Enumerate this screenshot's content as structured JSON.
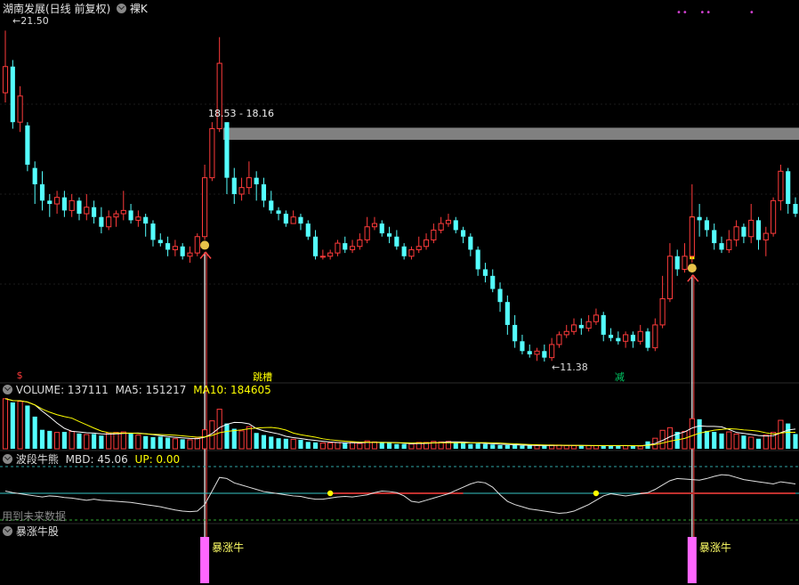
{
  "header": {
    "title": "湖南发展(日线 前复权)",
    "mode": "裸K"
  },
  "colors": {
    "up": "#ff3b3b",
    "down": "#54ffff",
    "ma5": "#ffffff",
    "ma10": "#ffff00",
    "signal": "#ffff00",
    "bull": "#ff66ff",
    "band": "#808080"
  },
  "price_panel": {
    "high_label": "21.50",
    "low_label": "11.38",
    "band_label": "18.53 - 18.16",
    "markers": [
      {
        "index": 2,
        "text": "$",
        "color": "#ff3b3b"
      },
      {
        "index": 34,
        "text": "跳槽",
        "color": "#ffff00"
      },
      {
        "index": 83,
        "text": "减",
        "color": "#00cc66"
      }
    ]
  },
  "volume_panel": {
    "label": "VOLUME: 137111",
    "ma5": "MA5: 151217",
    "ma10": "MA10: 184605"
  },
  "indicator_panel": {
    "name": "波段牛熊",
    "mbd": "MBD: 45.06",
    "up": "UP: 0.00",
    "future_note": "用到未来数据"
  },
  "bull_panel": {
    "name": "暴涨牛股",
    "signal_label": "暴涨牛"
  },
  "chart_data": {
    "type": "candlestick",
    "candles": [
      [
        19.6,
        20.4,
        21.5,
        19.3
      ],
      [
        20.4,
        18.7,
        20.6,
        18.5
      ],
      [
        18.7,
        19.5,
        19.8,
        18.4
      ],
      [
        18.6,
        17.4,
        18.7,
        17.2
      ],
      [
        17.3,
        16.8,
        17.5,
        16.2
      ],
      [
        16.8,
        16.3,
        17.2,
        16.0
      ],
      [
        16.3,
        16.2,
        16.5,
        15.8
      ],
      [
        16.2,
        16.4,
        16.6,
        15.9
      ],
      [
        16.4,
        16.0,
        16.6,
        15.8
      ],
      [
        16.0,
        16.3,
        16.5,
        15.8
      ],
      [
        16.3,
        15.9,
        16.4,
        15.7
      ],
      [
        15.9,
        16.1,
        16.5,
        15.7
      ],
      [
        16.1,
        15.8,
        16.3,
        15.6
      ],
      [
        15.8,
        15.5,
        16.1,
        15.3
      ],
      [
        15.5,
        15.8,
        16.0,
        15.4
      ],
      [
        15.8,
        15.9,
        16.0,
        15.5
      ],
      [
        15.9,
        16.0,
        16.6,
        15.7
      ],
      [
        16.0,
        15.7,
        16.2,
        15.6
      ],
      [
        15.7,
        15.8,
        16.0,
        15.5
      ],
      [
        15.8,
        15.6,
        15.9,
        15.2
      ],
      [
        15.6,
        15.1,
        15.7,
        14.9
      ],
      [
        15.1,
        15.0,
        15.3,
        14.9
      ],
      [
        15.0,
        14.8,
        15.2,
        14.6
      ],
      [
        14.8,
        14.9,
        15.1,
        14.6
      ],
      [
        14.9,
        14.6,
        15.0,
        14.5
      ],
      [
        14.6,
        14.7,
        14.9,
        14.4
      ],
      [
        14.7,
        15.2,
        15.3,
        14.6
      ],
      [
        15.2,
        17.0,
        17.4,
        15.1
      ],
      [
        17.0,
        18.5,
        18.7,
        16.9
      ],
      [
        18.5,
        20.5,
        21.3,
        18.4
      ],
      [
        18.7,
        17.0,
        18.5,
        16.5
      ],
      [
        17.0,
        16.5,
        17.3,
        16.2
      ],
      [
        16.5,
        16.7,
        17.0,
        16.3
      ],
      [
        16.7,
        17.0,
        17.5,
        16.5
      ],
      [
        17.0,
        16.8,
        17.2,
        16.3
      ],
      [
        16.8,
        16.3,
        17.0,
        16.1
      ],
      [
        16.3,
        16.0,
        16.6,
        15.9
      ],
      [
        16.0,
        15.9,
        16.1,
        15.7
      ],
      [
        15.9,
        15.6,
        16.0,
        15.5
      ],
      [
        15.6,
        15.8,
        16.0,
        15.6
      ],
      [
        15.8,
        15.6,
        15.9,
        15.4
      ],
      [
        15.6,
        15.2,
        15.7,
        15.1
      ],
      [
        15.2,
        14.6,
        15.4,
        14.5
      ],
      [
        14.6,
        14.6,
        14.8,
        14.5
      ],
      [
        14.6,
        14.7,
        14.8,
        14.5
      ],
      [
        14.7,
        15.0,
        15.1,
        14.6
      ],
      [
        15.0,
        14.8,
        15.2,
        14.7
      ],
      [
        14.8,
        14.9,
        15.1,
        14.7
      ],
      [
        14.9,
        15.1,
        15.3,
        14.8
      ],
      [
        15.1,
        15.5,
        15.8,
        15.0
      ],
      [
        15.5,
        15.6,
        15.8,
        15.4
      ],
      [
        15.6,
        15.3,
        15.7,
        15.2
      ],
      [
        15.3,
        15.2,
        15.5,
        15.0
      ],
      [
        15.2,
        14.9,
        15.4,
        14.8
      ],
      [
        14.9,
        14.6,
        15.0,
        14.5
      ],
      [
        14.6,
        14.8,
        14.9,
        14.5
      ],
      [
        14.8,
        14.9,
        15.2,
        14.7
      ],
      [
        14.9,
        15.1,
        15.3,
        14.8
      ],
      [
        15.1,
        15.4,
        15.6,
        15.0
      ],
      [
        15.4,
        15.6,
        15.8,
        15.3
      ],
      [
        15.6,
        15.7,
        15.9,
        15.5
      ],
      [
        15.7,
        15.4,
        15.8,
        15.3
      ],
      [
        15.4,
        15.2,
        15.5,
        15.0
      ],
      [
        15.2,
        14.8,
        15.3,
        14.6
      ],
      [
        14.8,
        14.2,
        14.9,
        14.0
      ],
      [
        14.2,
        14.0,
        14.4,
        13.8
      ],
      [
        14.0,
        13.6,
        14.2,
        13.5
      ],
      [
        13.6,
        13.2,
        13.8,
        12.9
      ],
      [
        13.2,
        12.5,
        13.4,
        12.2
      ],
      [
        12.5,
        12.0,
        12.8,
        11.8
      ],
      [
        12.0,
        11.7,
        12.2,
        11.6
      ],
      [
        11.7,
        11.6,
        11.9,
        11.5
      ],
      [
        11.6,
        11.7,
        11.8,
        11.4
      ],
      [
        11.7,
        11.5,
        11.9,
        11.38
      ],
      [
        11.5,
        11.9,
        12.1,
        11.4
      ],
      [
        11.9,
        12.2,
        12.3,
        11.8
      ],
      [
        12.2,
        12.3,
        12.5,
        12.1
      ],
      [
        12.3,
        12.5,
        12.7,
        12.2
      ],
      [
        12.5,
        12.4,
        12.7,
        12.2
      ],
      [
        12.4,
        12.6,
        12.8,
        12.3
      ],
      [
        12.6,
        12.8,
        13.0,
        12.5
      ],
      [
        12.8,
        12.2,
        12.9,
        12.0
      ],
      [
        12.2,
        12.1,
        12.4,
        12.0
      ],
      [
        12.1,
        12.0,
        12.3,
        11.9
      ],
      [
        12.0,
        12.2,
        12.3,
        11.8
      ],
      [
        12.2,
        12.0,
        12.3,
        11.8
      ],
      [
        12.0,
        12.3,
        12.5,
        11.9
      ],
      [
        12.3,
        11.8,
        12.4,
        11.7
      ],
      [
        11.8,
        12.5,
        12.7,
        11.7
      ],
      [
        12.5,
        13.3,
        14.0,
        12.4
      ],
      [
        13.3,
        14.6,
        15.0,
        13.2
      ],
      [
        14.6,
        14.2,
        14.8,
        14.0
      ],
      [
        14.2,
        14.6,
        15.0,
        14.1
      ],
      [
        14.6,
        15.8,
        16.8,
        14.4
      ],
      [
        15.8,
        15.7,
        16.2,
        15.2
      ],
      [
        15.7,
        15.4,
        15.8,
        15.2
      ],
      [
        15.4,
        15.0,
        15.6,
        14.8
      ],
      [
        15.0,
        14.8,
        15.2,
        14.7
      ],
      [
        14.8,
        15.1,
        15.4,
        14.7
      ],
      [
        15.1,
        15.5,
        15.7,
        14.9
      ],
      [
        15.5,
        15.2,
        15.6,
        15.0
      ],
      [
        15.2,
        15.7,
        16.2,
        15.0
      ],
      [
        15.7,
        15.1,
        15.8,
        14.8
      ],
      [
        15.1,
        15.3,
        15.5,
        14.6
      ],
      [
        15.3,
        16.3,
        16.4,
        15.2
      ],
      [
        16.3,
        17.2,
        17.4,
        16.0
      ],
      [
        17.2,
        16.2,
        17.3,
        15.9
      ],
      [
        16.2,
        15.9,
        16.4,
        15.8
      ]
    ],
    "volume": [
      9.5,
      8.8,
      9.0,
      8.2,
      6.1,
      3.6,
      3.4,
      3.1,
      3.2,
      3.3,
      2.9,
      2.7,
      2.8,
      2.5,
      3.0,
      3.1,
      3.2,
      3.0,
      2.6,
      2.4,
      2.2,
      2.3,
      2.1,
      1.9,
      1.8,
      1.7,
      2.0,
      3.6,
      5.3,
      7.5,
      4.8,
      3.8,
      3.4,
      4.2,
      3.0,
      2.6,
      2.3,
      2.0,
      1.9,
      1.8,
      1.7,
      1.3,
      1.2,
      1.1,
      1.1,
      1.2,
      1.1,
      1.2,
      1.0,
      1.5,
      1.3,
      1.1,
      1.1,
      0.9,
      0.9,
      0.9,
      1.2,
      1.2,
      1.4,
      1.3,
      1.4,
      1.2,
      1.1,
      0.9,
      1.0,
      0.9,
      0.8,
      0.7,
      0.7,
      0.7,
      0.6,
      0.6,
      0.6,
      0.6,
      0.7,
      0.7,
      0.6,
      0.6,
      0.6,
      0.6,
      0.6,
      0.6,
      0.6,
      0.6,
      0.6,
      0.5,
      0.5,
      1.4,
      2.0,
      3.5,
      4.0,
      3.2,
      3.3,
      5.7,
      5.6,
      3.4,
      3.2,
      2.9,
      3.2,
      2.8,
      2.5,
      2.2,
      1.9,
      2.6,
      3.1,
      5.4,
      4.8,
      2.8
    ],
    "volume_ylim": [
      0,
      9.8
    ],
    "ylim": [
      11.0,
      22.0
    ],
    "band": [
      18.16,
      18.53
    ],
    "band_start_index": 30,
    "signals": [
      {
        "index": 27,
        "label": "暴涨牛"
      },
      {
        "index": 93,
        "label": "暴涨牛"
      }
    ],
    "mbd_line": [
      55,
      52,
      50,
      48,
      46,
      44,
      46,
      45,
      43,
      42,
      40,
      38,
      40,
      38,
      37,
      36,
      35,
      34,
      32,
      30,
      28,
      26,
      23,
      20,
      18,
      17,
      18,
      30,
      55,
      80,
      78,
      70,
      66,
      62,
      58,
      54,
      52,
      50,
      48,
      46,
      45,
      42,
      40,
      40,
      42,
      44,
      45,
      44,
      46,
      48,
      52,
      55,
      54,
      52,
      46,
      36,
      34,
      38,
      42,
      46,
      50,
      56,
      62,
      68,
      72,
      70,
      62,
      48,
      36,
      30,
      26,
      22,
      20,
      18,
      16,
      14,
      15,
      18,
      24,
      30,
      38,
      46,
      50,
      48,
      46,
      48,
      50,
      52,
      58,
      66,
      74,
      78,
      77,
      76,
      75,
      78,
      82,
      85,
      84,
      80,
      76,
      74,
      72,
      70,
      68,
      72,
      70,
      68,
      66,
      64,
      65
    ],
    "mbd_ylim": [
      0,
      100
    ],
    "mbd_dots": [
      44,
      80
    ],
    "up_segments": [
      [
        44,
        62
      ],
      [
        86,
        112
      ]
    ]
  }
}
